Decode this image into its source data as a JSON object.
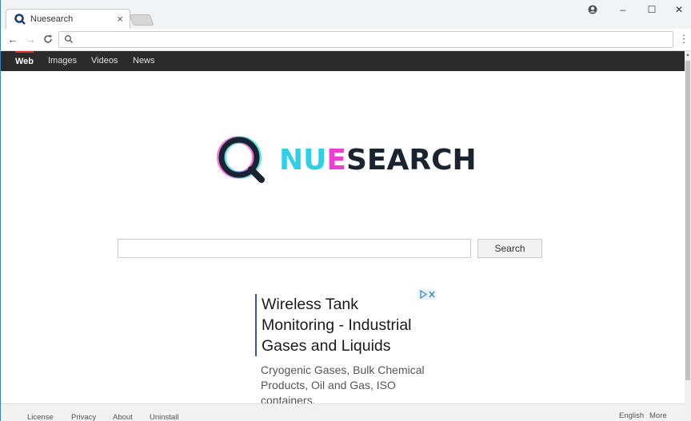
{
  "browser": {
    "tab_title": "Nuesearch",
    "tab_close": "×",
    "omnibox_value": "",
    "window_controls": {
      "minimize": "–",
      "maximize": "☐",
      "close": "✕"
    },
    "menu_glyph": "⋮"
  },
  "nav": {
    "items": [
      "Web",
      "Images",
      "Videos",
      "News"
    ],
    "active": "Web"
  },
  "logo": {
    "part1": "NU",
    "part2": "E",
    "part3": "SEARCH"
  },
  "search": {
    "value": "",
    "button_label": "Search"
  },
  "ad": {
    "title": "Wireless Tank Monitoring - Industrial Gases and Liquids",
    "description": "Cryogenic Gases, Bulk Chemical Products, Oil and Gas, ISO containers."
  },
  "footer": {
    "links": [
      "License",
      "Privacy",
      "About",
      "Uninstall"
    ],
    "right_links": [
      "English",
      "More"
    ]
  },
  "colors": {
    "logo_cyan": "#2fd0e6",
    "logo_magenta": "#ec3fd0",
    "logo_dark": "#1a2430",
    "ad_bar": "#3f51b5",
    "nav_bg": "#2b2b2b"
  }
}
